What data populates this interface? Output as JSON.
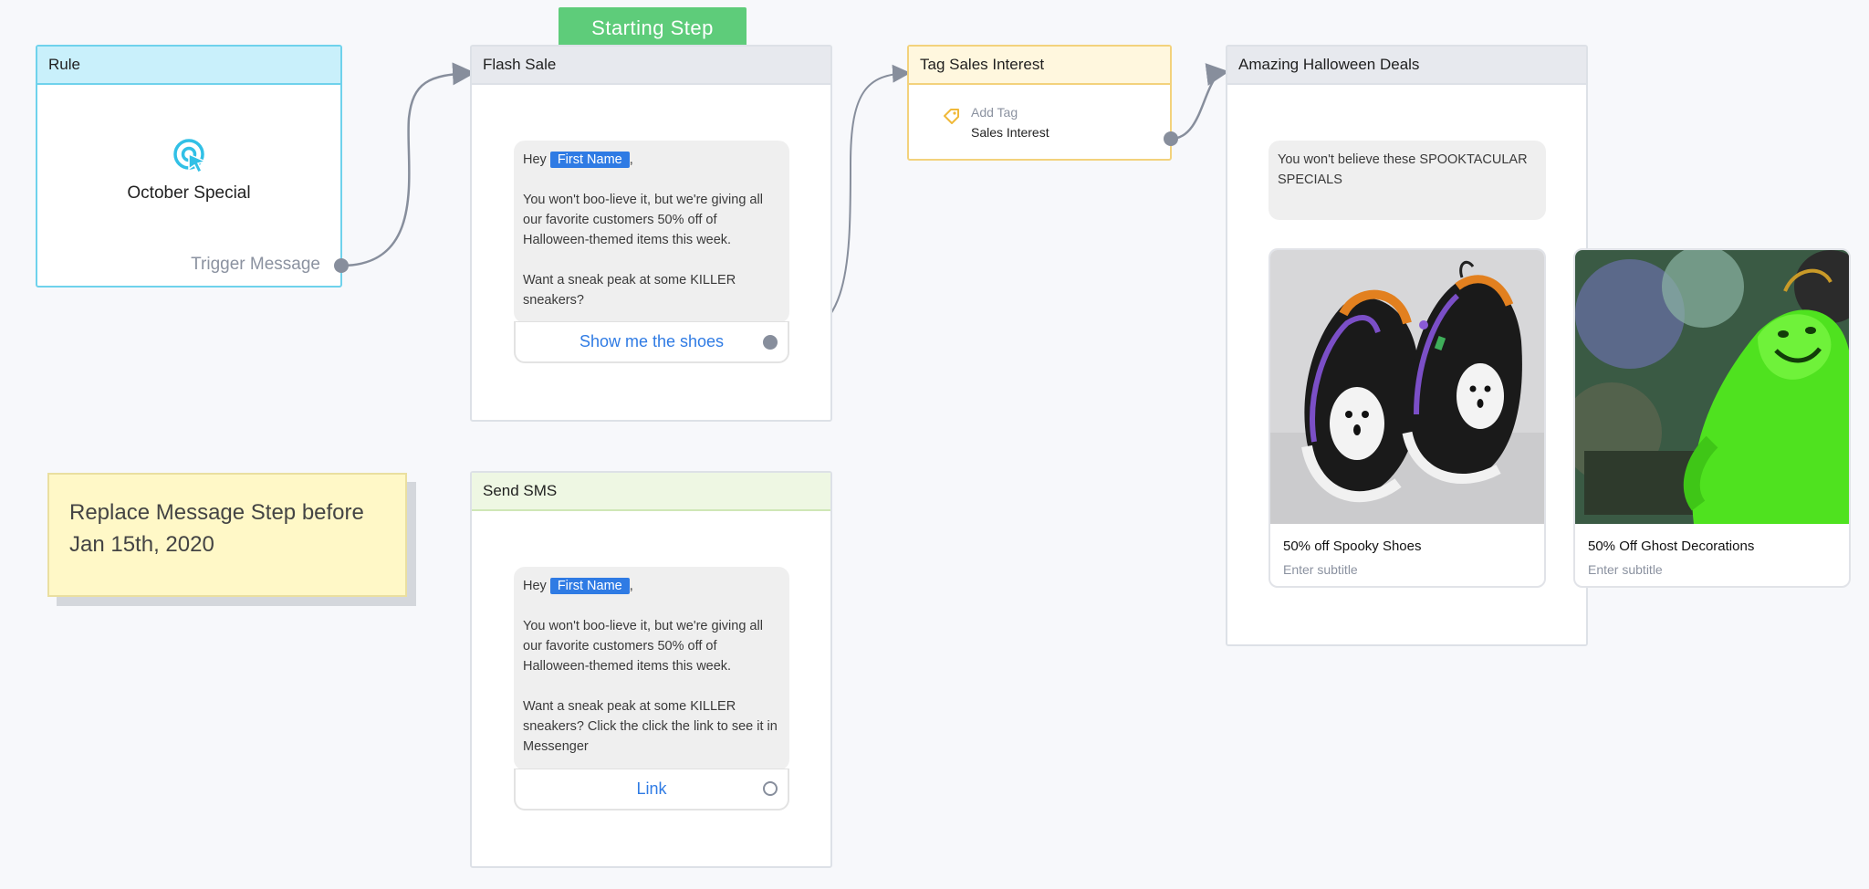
{
  "badge": {
    "starting_step": "Starting Step"
  },
  "rule": {
    "header": "Rule",
    "title": "October Special",
    "trigger_label": "Trigger Message"
  },
  "flash_sale": {
    "header": "Flash Sale",
    "greeting_prefix": "Hey",
    "chip": "First Name",
    "greeting_suffix": ",",
    "para1": "You won't boo-lieve it, but we're giving all our favorite customers 50% off of Halloween-themed items this week.",
    "para2": "Want a sneak peak at some KILLER sneakers?",
    "button": "Show me the shoes"
  },
  "tag_sales": {
    "header": "Tag Sales Interest",
    "action": "Add Tag",
    "value": "Sales Interest"
  },
  "halloween": {
    "header": "Amazing Halloween Deals",
    "message": "You won't believe these SPOOKTACULAR SPECIALS",
    "cards": [
      {
        "title": "50% off Spooky Shoes",
        "subtitle": "Enter subtitle"
      },
      {
        "title": "50% Off Ghost Decorations",
        "subtitle": "Enter subtitle"
      }
    ]
  },
  "note": {
    "text": "Replace Message Step before Jan 15th, 2020"
  },
  "send_sms": {
    "header": "Send SMS",
    "greeting_prefix": "Hey",
    "chip": "First Name",
    "greeting_suffix": ",",
    "para1": "You won't boo-lieve it, but we're giving all our favorite customers 50% off of Halloween-themed items this week.",
    "para2": "Want a sneak peak at some KILLER sneakers? Click the click the link to see it in Messenger",
    "button": "Link"
  },
  "colors": {
    "accent_blue": "#2f7be4",
    "start_green": "#5ecc7a",
    "rule_cyan": "#6fd2ec",
    "tag_yellow": "#f3d27c",
    "connector_gray": "#878e9c"
  },
  "icons": [
    "target-pointer-icon",
    "tag-icon",
    "connector-arrow-icon"
  ]
}
